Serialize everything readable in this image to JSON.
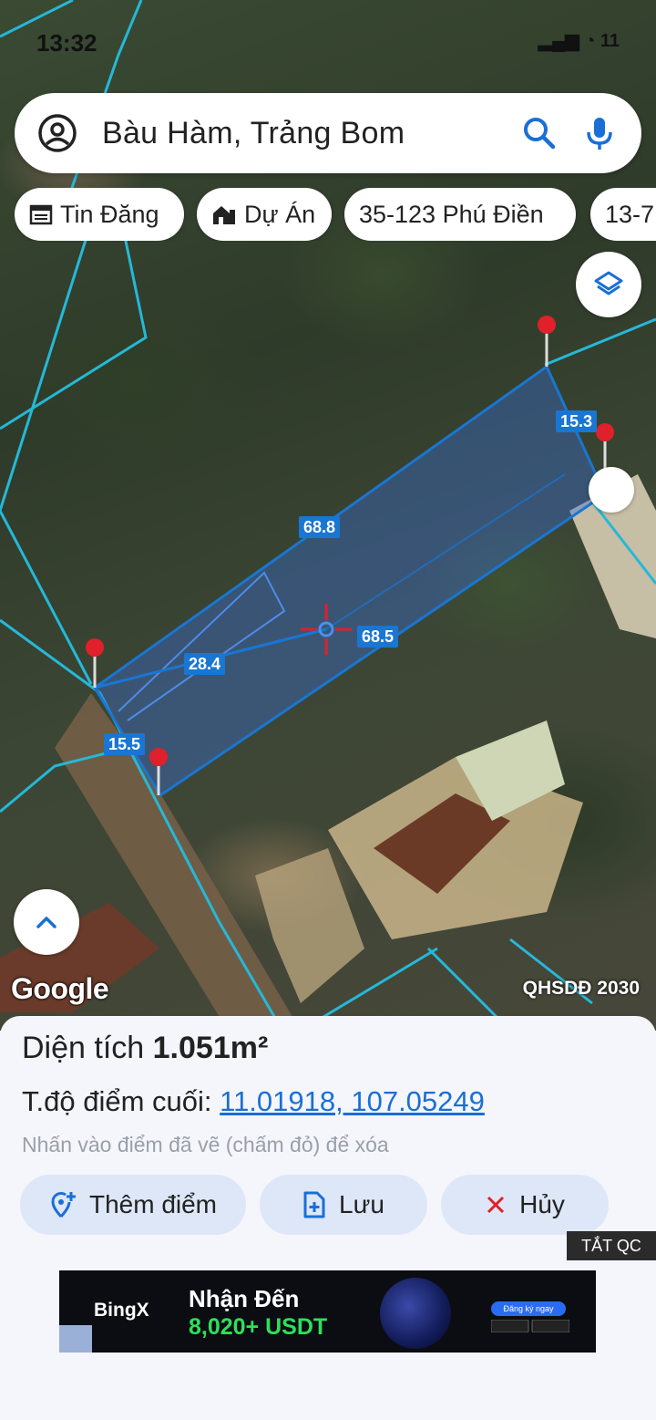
{
  "status_bar": {
    "time": "13:32",
    "battery": "11"
  },
  "search": {
    "query": "Bàu Hàm, Trảng Bom"
  },
  "chips": [
    {
      "label": "Tin Đăng",
      "icon": "calendar-icon"
    },
    {
      "label": "Dự Án",
      "icon": "building-icon"
    },
    {
      "label": "35-123 Phú Điền",
      "icon": ""
    },
    {
      "label": "13-7",
      "icon": ""
    }
  ],
  "map": {
    "dimensions": {
      "top_right": "15.3",
      "top_long": "68.8",
      "inner_right": "68.5",
      "diagonal": "28.4",
      "bottom_left": "15.5"
    },
    "attribution": "Google",
    "layer_label": "QHSDĐ 2030"
  },
  "panel": {
    "area_label": "Diện tích",
    "area_value": "1.051m²",
    "coord_label": "T.độ điểm cuối:",
    "coord_value": "11.01918, 107.05249",
    "hint": "Nhấn vào điểm đã vẽ (chấm đỏ) để xóa",
    "buttons": {
      "add": "Thêm điểm",
      "save": "Lưu",
      "cancel": "Hủy"
    },
    "ad_toggle": "TẮT QC"
  },
  "ad": {
    "brand": "BingX",
    "headline": "Nhận Đến",
    "amount": "8,020+ USDT",
    "cta": "Đăng ký ngay"
  },
  "colors": {
    "accent": "#1976d2",
    "pin": "#e0202a",
    "button_bg": "#dde7f7",
    "link": "#1a6fd6"
  }
}
